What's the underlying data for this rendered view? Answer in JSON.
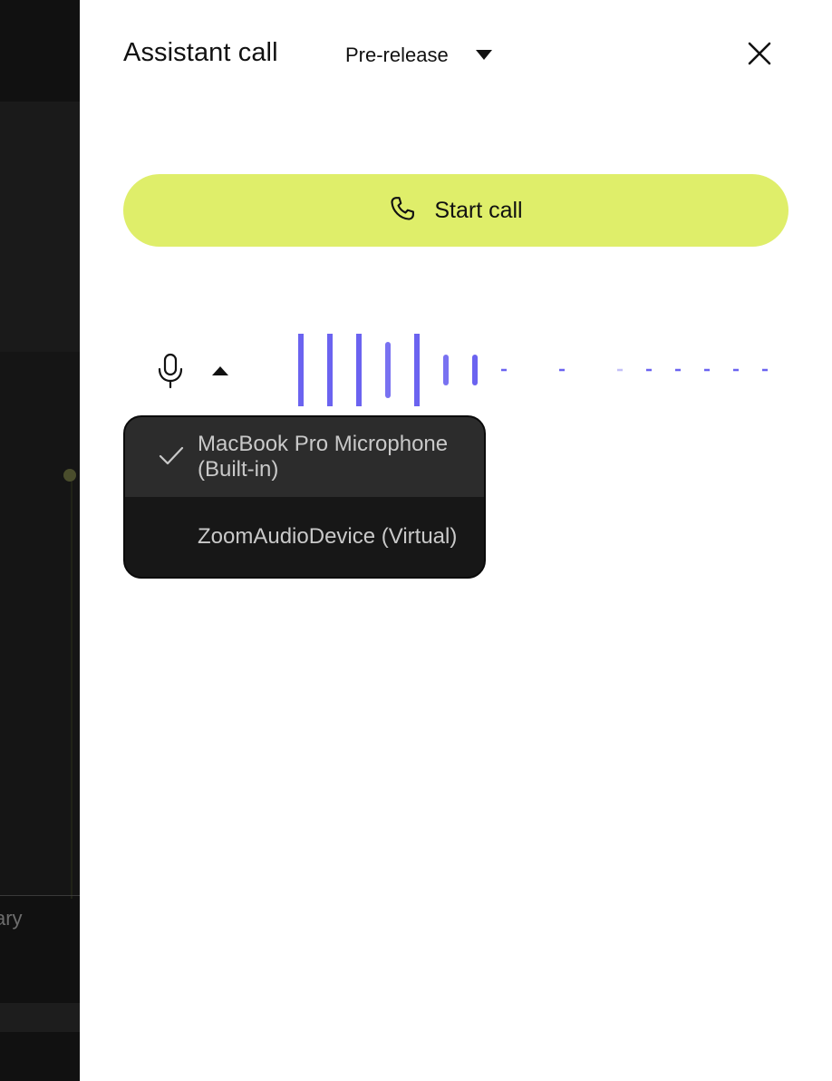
{
  "panel": {
    "title": "Assistant call",
    "version_select": {
      "selected": "Pre-release"
    },
    "start_call_label": "Start call"
  },
  "mic": {
    "devices": [
      {
        "label": "MacBook Pro Microphone (Built-in)",
        "selected": true
      },
      {
        "label": "ZoomAudioDevice (Virtual)",
        "selected": false
      }
    ]
  },
  "background_app": {
    "partial_text": "ary"
  },
  "colors": {
    "accent": "#dfee6a",
    "waveform": "#6b63f0",
    "dropdown_bg": "#171717",
    "dropdown_selected_bg": "#2c2c2c"
  }
}
